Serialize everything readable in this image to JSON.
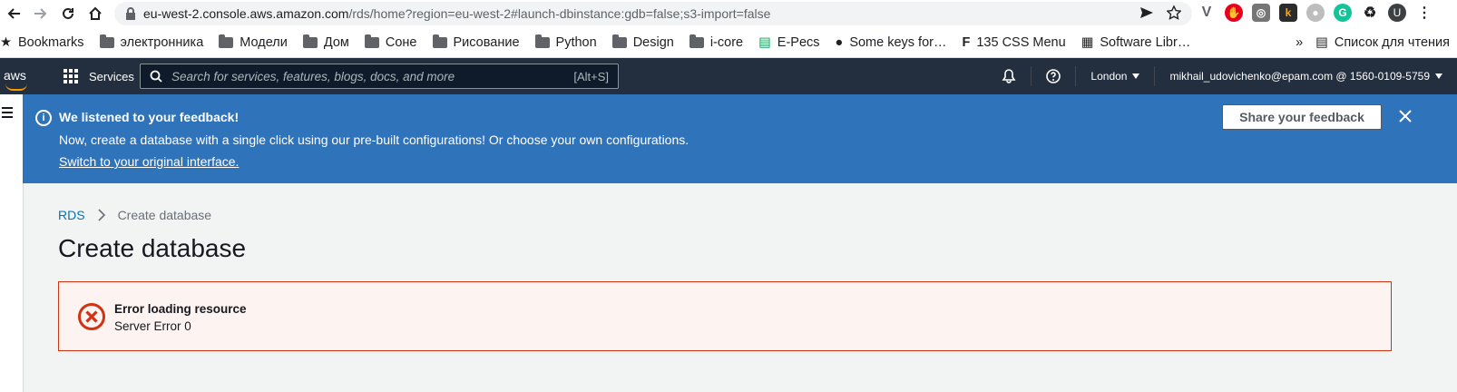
{
  "browser": {
    "url_host": "eu-west-2.console.aws.amazon.com",
    "url_rest": "/rds/home?region=eu-west-2#launch-dbinstance:gdb=false;s3-import=false",
    "avatar_letter": "U"
  },
  "bookmarks": {
    "items": [
      "Bookmarks",
      "электронника",
      "Модели",
      "Дом",
      "Соне",
      "Рисование",
      "Python",
      "Design",
      "i-core",
      "E-Pecs",
      "Some keys for…",
      "135 CSS Menu",
      "Software Libr…"
    ],
    "overflow": "»",
    "reading_list": "Список для чтения"
  },
  "awsnav": {
    "logo": "aws",
    "services_label": "Services",
    "search_placeholder": "Search for services, features, blogs, docs, and more",
    "search_shortcut": "[Alt+S]",
    "region": "London",
    "account": "mikhail_udovichenko@epam.com @ 1560-0109-5759"
  },
  "banner": {
    "title": "We listened to your feedback!",
    "text": "Now, create a database with a single click using our pre-built configurations! Or choose your own configurations.",
    "link": "Switch to your original interface.",
    "button": "Share your feedback",
    "color": "#2f73bb"
  },
  "breadcrumb": {
    "root": "RDS",
    "current": "Create database"
  },
  "page": {
    "title": "Create database"
  },
  "error": {
    "title": "Error loading resource",
    "message": "Server Error 0",
    "color": "#d13212"
  }
}
